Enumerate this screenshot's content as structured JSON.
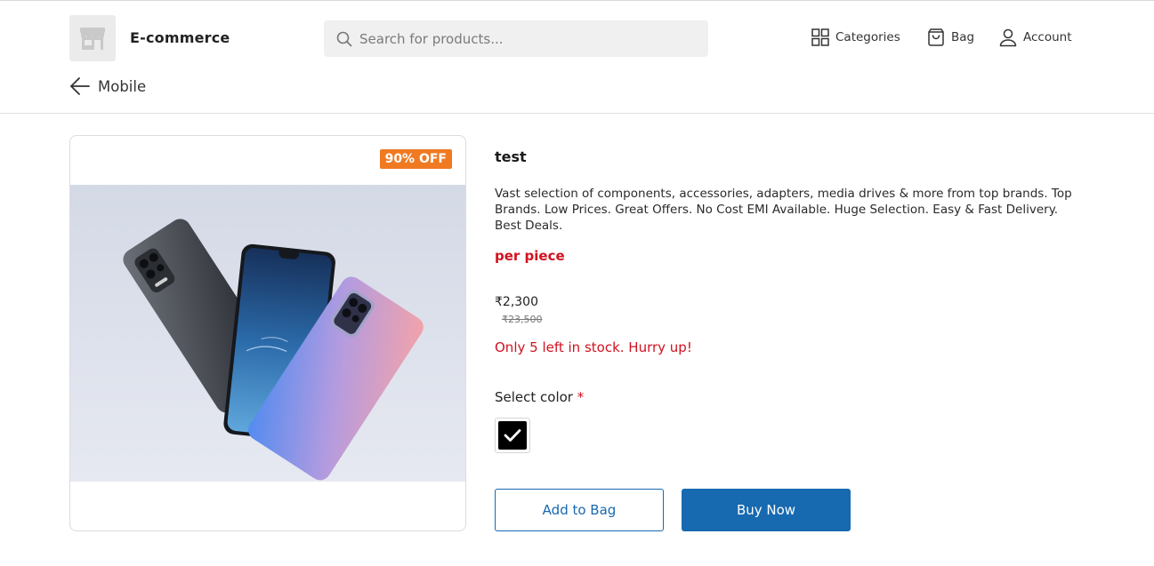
{
  "header": {
    "brand": "E-commerce",
    "search_placeholder": "Search for products...",
    "nav": {
      "categories": "Categories",
      "bag": "Bag",
      "account": "Account"
    },
    "icons": [
      "store-icon",
      "search-icon",
      "grid-icon",
      "bag-icon",
      "user-icon",
      "arrow-left-icon"
    ]
  },
  "breadcrumb": {
    "label": "Mobile"
  },
  "product": {
    "discount_badge": "90% OFF",
    "title": "test",
    "description": "Vast selection of components, accessories, adapters, media drives & more from top brands. Top Brands. Low Prices. Great Offers. No Cost EMI Available. Huge Selection. Easy & Fast Delivery. Best Deals.",
    "unit": "per piece",
    "price": "₹2,300",
    "mrp": "₹23,500",
    "stock_message": "Only 5 left in stock. Hurry up!",
    "color_label": "Select color",
    "required_mark": "*",
    "selected_color": "#000000",
    "add_to_bag": "Add to Bag",
    "buy_now": "Buy Now"
  },
  "colors": {
    "accent": "#1769b0",
    "alert": "#d0121f",
    "badge": "#ef7a22"
  }
}
